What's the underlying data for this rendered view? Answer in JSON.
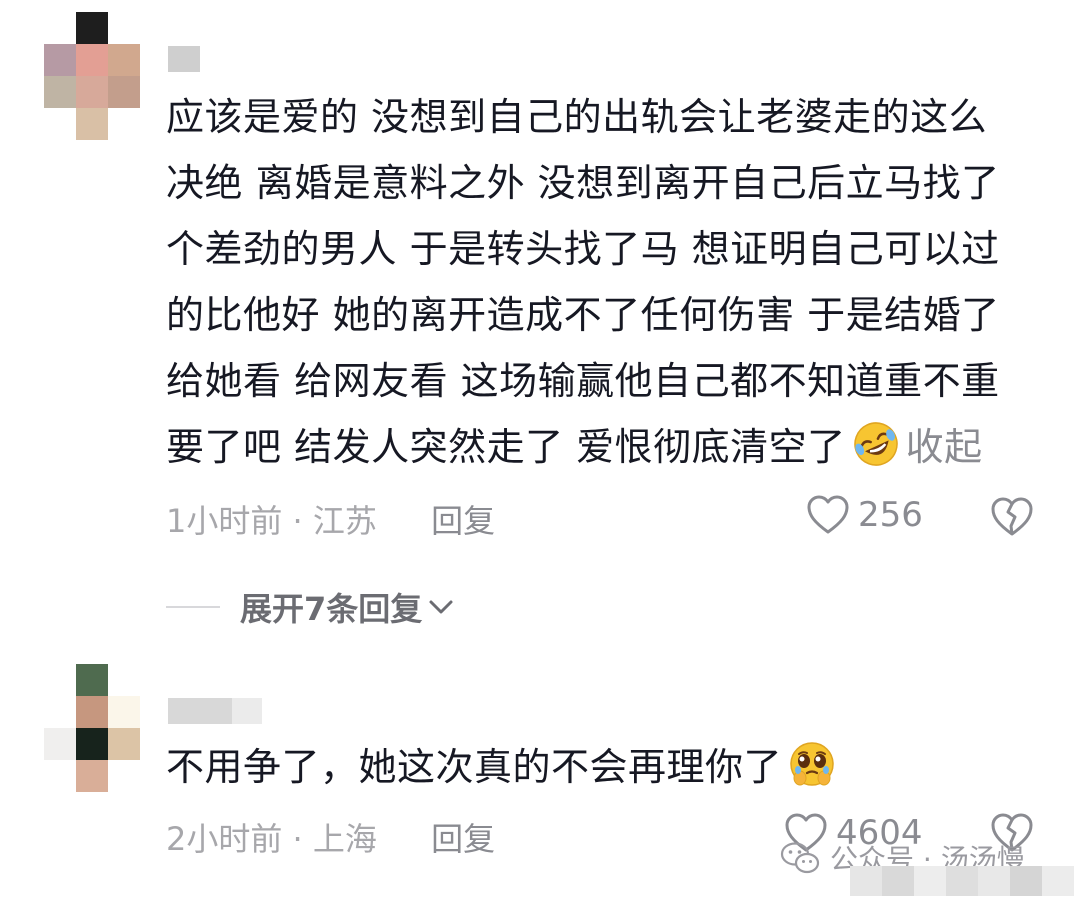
{
  "comments": [
    {
      "username": "",
      "text": "应该是爱的 没想到自己的出轨会让老婆走的这么决绝 离婚是意料之外 没想到离开自己后立马找了个差劲的男人 于是转头找了马 想证明自己可以过的比他好 她的离开造成不了任何伤害 于是结婚了给她看 给网友看 这场输赢他自己都不知道重不重要了吧 结发人突然走了 爱恨彻底清空了",
      "text_lines": [
        "应该是爱的 没想到自己的出轨会让老婆走的这么",
        "决绝 离婚是意料之外 没想到离开自己后立马找了",
        "个差劲的男人 于是转头找了马 想证明自己可以过",
        "的比他好 她的离开造成不了任何伤害 于是结婚了",
        "给她看 给网友看 这场输赢他自己都不知道重不重",
        "要了吧 结发人突然走了 爱恨彻底清空了"
      ],
      "emoji": "rolling-on-floor-laughing-emoji",
      "collapse_label": "收起",
      "time": "1小时前",
      "separator": "·",
      "location": "江苏",
      "reply_label": "回复",
      "likes": "256",
      "expand_label": "展开7条回复"
    },
    {
      "username": "",
      "text": "不用争了，她这次真的不会再理你了",
      "emoji": "pleading-face-emoji",
      "time": "2小时前",
      "separator": "·",
      "location": "上海",
      "reply_label": "回复",
      "likes": "4604"
    }
  ],
  "watermark": {
    "text": "公众号 · 汤汤慢",
    "icon": "wechat-icon"
  },
  "colors": {
    "text": "#161823",
    "meta": "#a7a7ab",
    "secondary": "#8a8b91",
    "emoji": "#f7c531"
  }
}
